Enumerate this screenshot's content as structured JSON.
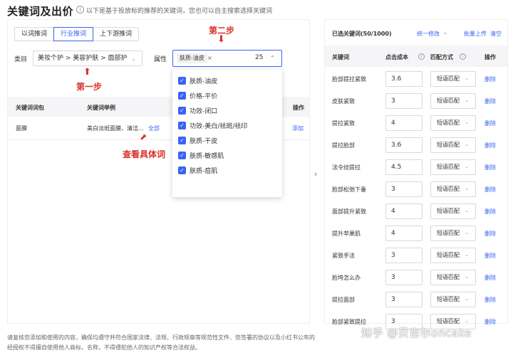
{
  "page": {
    "title": "关键词及出价",
    "subtitle": "以下是基于投放标的推荐的关键词，您也可以自主搜索选择关键词"
  },
  "tabs": [
    "以词推词",
    "行业推词",
    "上下游推词"
  ],
  "filters": {
    "category_label": "类目",
    "category_value": "美妆个护 > 美容护肤 > 面部护理",
    "attribute_label": "属性",
    "attribute_tag": "肤质-油皮",
    "attribute_count": "25"
  },
  "annotations": {
    "step1": "第一步",
    "step2": "第二步",
    "view_detail": "查看具体词"
  },
  "left_table": {
    "headers": [
      "关键词词包",
      "关键词举例",
      "操作"
    ],
    "rows": [
      {
        "package": "面膜",
        "example": "美白淡斑面膜、清洁...",
        "more": "全部",
        "action": "添加"
      }
    ]
  },
  "dropdown_options": [
    "肤质-油皮",
    "价格-平价",
    "功效-闭口",
    "功效-美白/祛斑/祛印",
    "肤质-干皮",
    "肤质-敏感肌",
    "肤质-痘肌"
  ],
  "right_panel": {
    "selected_label": "已选关键词(50/1000)",
    "bulk_edit": "统一修改",
    "bulk_upload": "批量上传",
    "clear": "清空",
    "headers": [
      "关键词",
      "点击成本",
      "匹配方式",
      "操作"
    ],
    "rows": [
      {
        "keyword": "脸部提拉紧致",
        "cost": "3.6",
        "match": "短语匹配",
        "action": "删除"
      },
      {
        "keyword": "皮肤紧致",
        "cost": "3",
        "match": "短语匹配",
        "action": "删除"
      },
      {
        "keyword": "提拉紧致",
        "cost": "4",
        "match": "短语匹配",
        "action": "删除"
      },
      {
        "keyword": "提拉脸部",
        "cost": "3.6",
        "match": "短语匹配",
        "action": "删除"
      },
      {
        "keyword": "法令纹提拉",
        "cost": "4.5",
        "match": "短语匹配",
        "action": "删除"
      },
      {
        "keyword": "脸部松弛下垂",
        "cost": "3",
        "match": "短语匹配",
        "action": "删除"
      },
      {
        "keyword": "面部提升紧致",
        "cost": "4",
        "match": "短语匹配",
        "action": "删除"
      },
      {
        "keyword": "提升苹果肌",
        "cost": "4",
        "match": "短语匹配",
        "action": "删除"
      },
      {
        "keyword": "紧致手法",
        "cost": "3",
        "match": "短语匹配",
        "action": "删除"
      },
      {
        "keyword": "脸垮怎么办",
        "cost": "3",
        "match": "短语匹配",
        "action": "删除"
      },
      {
        "keyword": "提拉面部",
        "cost": "3",
        "match": "短语匹配",
        "action": "删除"
      },
      {
        "keyword": "脸部紧致提拉",
        "cost": "3",
        "match": "短语匹配",
        "action": "删除"
      }
    ]
  },
  "footer": {
    "line1": "请复核您添加和使用的内容，确保均遵守并符合国家法律、法规、行政规章等规范性文件、您签署的协议以及小红书公布的",
    "line2": "经授权不得擅自使用他人商标、名称，不得侵犯他人的知识产权等合法权益。"
  },
  "watermark": "知乎 @贝吉尔oncake",
  "colors": {
    "accent": "#3a63f3",
    "annotation": "#d9312b"
  }
}
